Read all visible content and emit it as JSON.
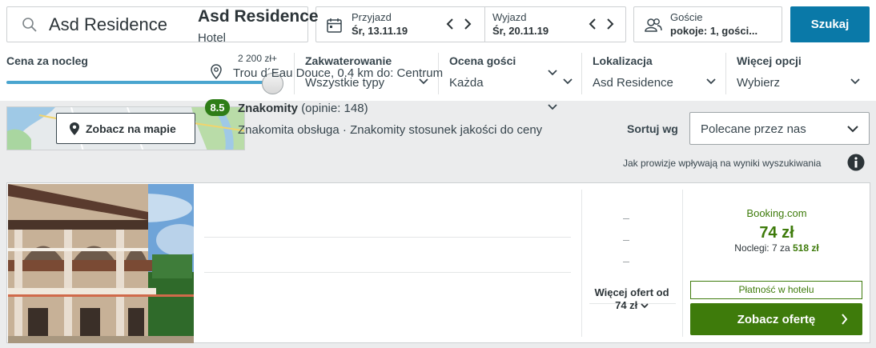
{
  "search": {
    "query": "Asd Residence",
    "button": "Szukaj"
  },
  "dates": {
    "checkin_label": "Przyjazd",
    "checkin_value": "Śr, 13.11.19",
    "checkout_label": "Wyjazd",
    "checkout_value": "Śr, 20.11.19"
  },
  "guests": {
    "label": "Goście",
    "value": "pokoje: 1, gości..."
  },
  "price_filter": {
    "label": "Cena za nocleg",
    "max": "2 200 zł+",
    "level_fraction": 1.0
  },
  "filters": [
    {
      "title": "Zakwaterowanie",
      "value": "Wszystkie typy"
    },
    {
      "title": "Ocena gości",
      "value": "Każda"
    },
    {
      "title": "Lokalizacja",
      "value": "Asd Residence"
    },
    {
      "title": "Więcej opcji",
      "value": "Wybierz"
    }
  ],
  "map": {
    "button": "Zobacz na mapie"
  },
  "sort": {
    "label": "Sortuj wg",
    "value": "Polecane przez nas"
  },
  "commission_note": "Jak prowizje wpływają na wyniki wyszukiwania",
  "hotel": {
    "name": "Asd Residence",
    "type": "Hotel",
    "location": "Trou d´Eau Douce, 0.4 km do: Centrum",
    "score": "8.5",
    "rating_word": "Znakomity",
    "reviews": "(opinie: 148)",
    "highlights": "Znakomita obsługa · Znakomity stosunek jakości do ceny"
  },
  "offers": {
    "more_line1": "Więcej ofert od",
    "more_line2": "74 zł",
    "provider": "Booking.com",
    "price": "74 zł",
    "nights_prefix": "Noclegi: 7 za",
    "nights_total": "518 zł",
    "pay_at_hotel": "Płatność w hotelu",
    "cta": "Zobacz ofertę"
  },
  "colors": {
    "primary_blue": "#0a79a8",
    "deal_green": "#3e7b0b",
    "score_green": "#2e7d17",
    "slider_blue": "#4aa5cf",
    "panel_gray": "#ebeced"
  }
}
